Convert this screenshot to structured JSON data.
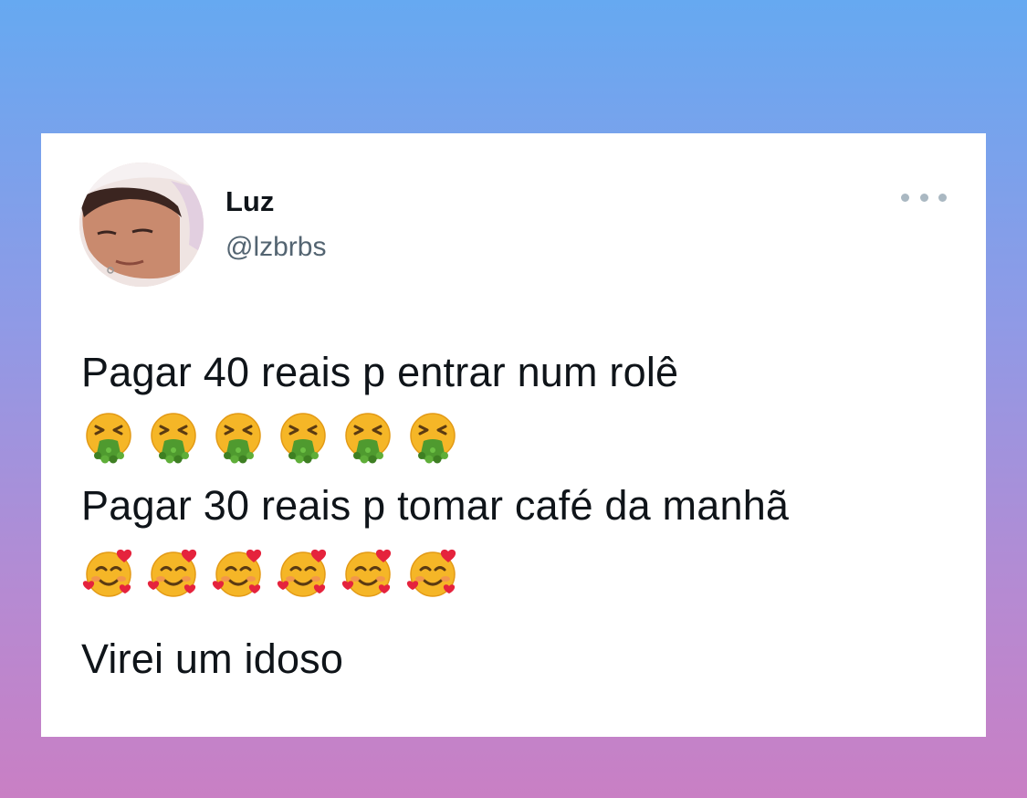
{
  "tweet": {
    "author_name": "Luz",
    "author_handle": "@lzbrbs",
    "lines": [
      "Pagar 40 reais p entrar num rolê",
      "Pagar 30 reais p tomar café da manhã",
      "Virei um idoso"
    ],
    "emoji_rows": [
      {
        "icon": "face-vomiting-icon",
        "count": 6
      },
      {
        "icon": "smiling-face-with-hearts-icon",
        "count": 6
      }
    ]
  },
  "colors": {
    "gradient_top": "#66a9f1",
    "gradient_bottom": "#c97fc4",
    "card_bg": "#ffffff",
    "text_primary": "#0f1419",
    "text_secondary": "#536471"
  }
}
